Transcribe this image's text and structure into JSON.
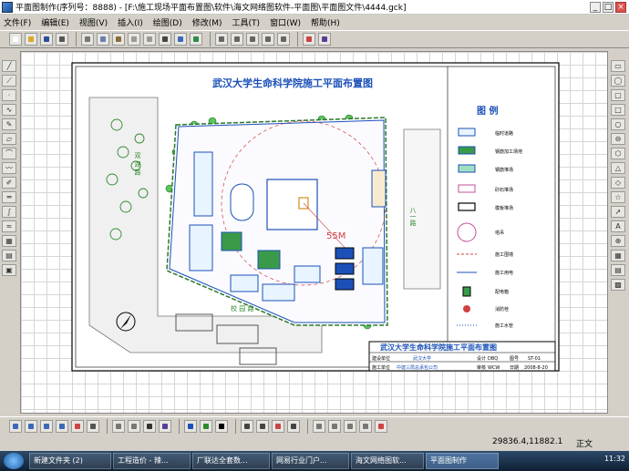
{
  "window": {
    "title": "平面图制作(序列号：8888) - [F:\\施工现场平面布置图\\软件\\海文网络图软件-平面图\\平面图文件\\4444.gck]",
    "minimize": "_",
    "maximize": "□",
    "close": "×"
  },
  "menu": [
    "文件(F)",
    "编辑(E)",
    "视图(V)",
    "插入(I)",
    "绘图(D)",
    "修改(M)",
    "工具(T)",
    "窗口(W)",
    "帮助(H)"
  ],
  "drawing": {
    "title": "武汉大学生命科学院施工平面布置图",
    "legend_title": "图 例",
    "legend_items": [
      "临时道路",
      "钢筋加工场地",
      "钢筋堆场",
      "砂石堆场",
      "模板堆场",
      "塔吊",
      "施工围墙",
      "施工用电",
      "配电箱",
      "消防栓",
      "施工水管"
    ],
    "labels": {
      "dim_55m": "55M",
      "road_left": "双 湖 路",
      "road_right": "八一路",
      "road_bottom": "校 园 路"
    },
    "titleblock": {
      "title": "武汉大学生命科学院施工平面布置图",
      "row1": [
        "建设单位",
        "武汉大学",
        "设计",
        "DBQ",
        "图号",
        "ST-01"
      ],
      "row2": [
        "施工单位",
        "中建三局总承包公司",
        "审核",
        "WCW",
        "日期",
        "2008-8-20"
      ]
    }
  },
  "status": {
    "coords": "29836.4,11882.1",
    "ime": "正文",
    "clock": "11:32"
  },
  "taskbar": {
    "items": [
      "新建文件夹 (2)",
      "工程造价 - 辣...",
      "厂联达全套数...",
      "网易行业门户...",
      "海文网络图软...",
      "平面图制作"
    ],
    "active_index": 5
  }
}
